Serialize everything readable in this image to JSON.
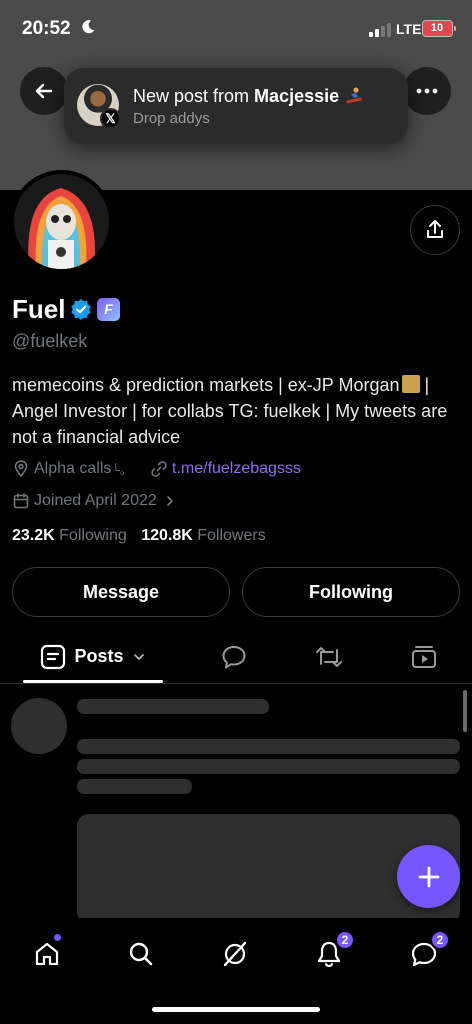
{
  "status_bar": {
    "time": "20:52",
    "network": "LTE",
    "battery": "10"
  },
  "notification": {
    "title_prefix": "New post from ",
    "author": "Macjessie",
    "subtitle": "Drop addys",
    "badge_icon": "x-logo-icon"
  },
  "profile": {
    "name": "Fuel",
    "handle": "@fuelkek",
    "bio_before_emoji": "memecoins & prediction markets | ex-JP Morgan",
    "bio_after_emoji": " | Angel Investor | for collabs TG: fuelkek | My tweets are not a financial advice",
    "location": "Alpha calls ",
    "location_suffix": "└。",
    "website": "t.me/fuelzebagsss",
    "joined": "Joined April 2022",
    "following_count": "23.2K",
    "following_label": "Following",
    "followers_count": "120.8K",
    "followers_label": "Followers"
  },
  "actions": {
    "message": "Message",
    "following": "Following"
  },
  "tabs": [
    {
      "label": "Posts",
      "icon": "posts-icon",
      "active": true
    },
    {
      "label": "",
      "icon": "replies-icon"
    },
    {
      "label": "",
      "icon": "reposts-icon"
    },
    {
      "label": "",
      "icon": "media-icon"
    }
  ],
  "bottom_nav": {
    "notifications_badge": "2",
    "messages_badge": "2",
    "items": [
      "home-icon",
      "search-icon",
      "grok-icon",
      "notifications-icon",
      "messages-icon"
    ]
  },
  "colors": {
    "accent": "#7856ff",
    "link": "#8b6ff5",
    "muted": "#71767b",
    "verified": "#1d9bf0"
  }
}
